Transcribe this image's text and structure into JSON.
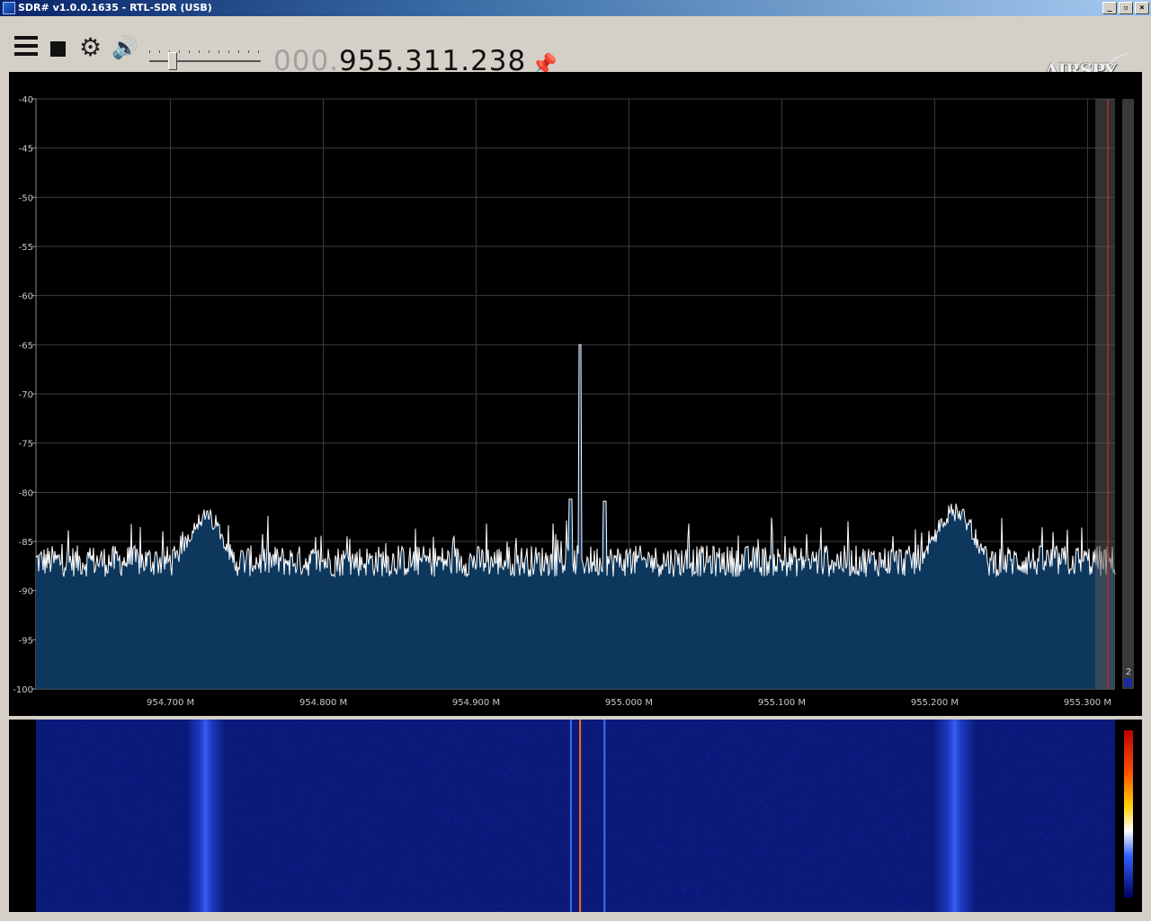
{
  "window": {
    "title": "SDR# v1.0.0.1635 - RTL-SDR (USB)",
    "btn_min": "_",
    "btn_restore": "▫",
    "btn_close": "×"
  },
  "toolbar": {
    "menu_icon": "hamburger-menu-icon",
    "stop_icon": "stop-icon",
    "settings_icon": "gear-icon",
    "audio_icon": "speaker-icon",
    "volume_level": 0.18,
    "freq_prefix": "000.",
    "freq_main": "955.311.238",
    "pin_icon": "pin-icon",
    "logo_text": "AIRSPY"
  },
  "spectrum": {
    "y_ticks": [
      "-40",
      "-45",
      "-50",
      "-55",
      "-60",
      "-65",
      "-70",
      "-75",
      "-80",
      "-85",
      "-90",
      "-95",
      "-100"
    ],
    "x_ticks": [
      "954.700 M",
      "954.800 M",
      "954.900 M",
      "955.000 M",
      "955.100 M",
      "955.200 M",
      "955.300 M"
    ],
    "ylim": [
      -100,
      -40
    ],
    "xlim_mhz": [
      954.612,
      955.318
    ],
    "noise_floor_db": -87,
    "features": [
      {
        "center_mhz": 954.723,
        "width_mhz": 0.018,
        "peak_db": -82.5
      },
      {
        "center_mhz": 955.213,
        "width_mhz": 0.02,
        "peak_db": -82
      },
      {
        "center_mhz": 954.962,
        "width_mhz": 0.0012,
        "peak_db": -80.7
      },
      {
        "center_mhz": 954.968,
        "width_mhz": 0.0008,
        "peak_db": -65
      },
      {
        "center_mhz": 954.984,
        "width_mhz": 0.0012,
        "peak_db": -80.9
      }
    ],
    "colors": {
      "fill": "#0e3a62",
      "trace": "#ffffff",
      "grid": "#3c3c3c",
      "marker": "#b42a2a"
    },
    "side_meter_label": "2"
  },
  "waterfall": {
    "colors": {
      "background": "#0a1a7a",
      "signal": "#ff6a1a"
    }
  }
}
